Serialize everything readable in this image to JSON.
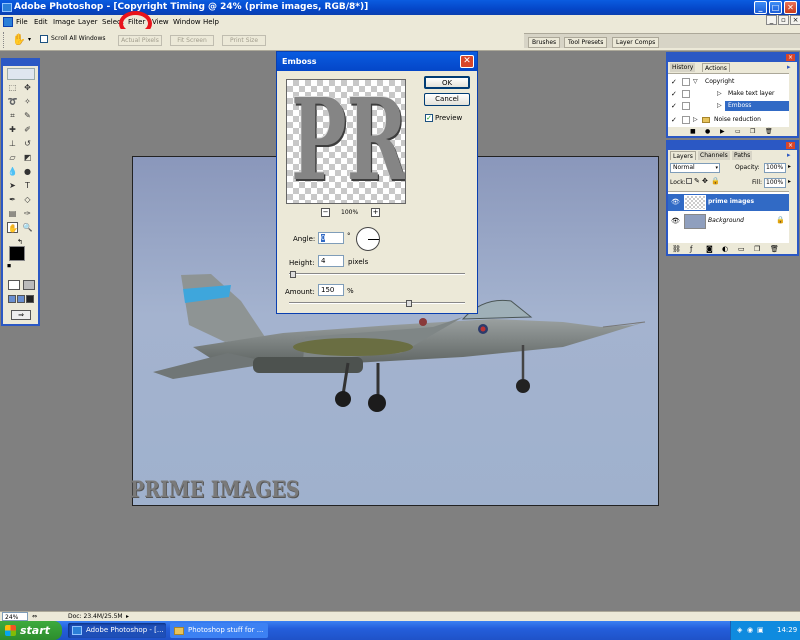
{
  "window": {
    "title": "Adobe Photoshop - [Copyright Timing @ 24% (prime images, RGB/8*)]"
  },
  "menu": [
    "File",
    "Edit",
    "Image",
    "Layer",
    "Select",
    "Filter",
    "View",
    "Window",
    "Help"
  ],
  "options_bar": {
    "scroll_all_windows": "Scroll All Windows",
    "actual_pixels": "Actual Pixels",
    "fit_screen": "Fit Screen",
    "print_size": "Print Size"
  },
  "palette_well": {
    "tabs": [
      "Brushes",
      "Tool Presets",
      "Layer Comps"
    ]
  },
  "emboss_dialog": {
    "title": "Emboss",
    "ok": "OK",
    "cancel": "Cancel",
    "preview_label": "Preview",
    "preview_checked": true,
    "preview_text": "PR",
    "zoom": "100%",
    "zoom_out": "−",
    "zoom_in": "+",
    "angle_label": "Angle:",
    "angle_value": "0",
    "angle_unit": "°",
    "height_label": "Height:",
    "height_value": "4",
    "height_unit": "pixels",
    "amount_label": "Amount:",
    "amount_value": "150",
    "amount_unit": "%"
  },
  "history_panel": {
    "tabs": [
      "History",
      "Actions"
    ],
    "items": [
      {
        "label": "Copyright",
        "selected": false
      },
      {
        "label": "Make text layer",
        "selected": false
      },
      {
        "label": "Emboss",
        "selected": true
      },
      {
        "label": "Noise reduction",
        "selected": false
      }
    ]
  },
  "layers_panel": {
    "tabs": [
      "Layers",
      "Channels",
      "Paths"
    ],
    "blend_mode": "Normal",
    "opacity_label": "Opacity:",
    "opacity_value": "100%",
    "lock_label": "Lock:",
    "fill_label": "Fill:",
    "fill_value": "100%",
    "layers": [
      {
        "name": "prime images",
        "selected": true
      },
      {
        "name": "Background",
        "selected": false
      }
    ]
  },
  "canvas": {
    "watermark": "PRIME IMAGES"
  },
  "status": {
    "zoom": "24%",
    "doc": "Doc: 23.4M/25.5M"
  },
  "taskbar": {
    "start": "start",
    "tasks": [
      "Adobe Photoshop - [...",
      "Photoshop stuff for ..."
    ],
    "clock": "14:29"
  },
  "colors": {
    "xp_blue": "#0446c8",
    "highlight_circle": "#e8141b",
    "selection": "#316ac5"
  }
}
